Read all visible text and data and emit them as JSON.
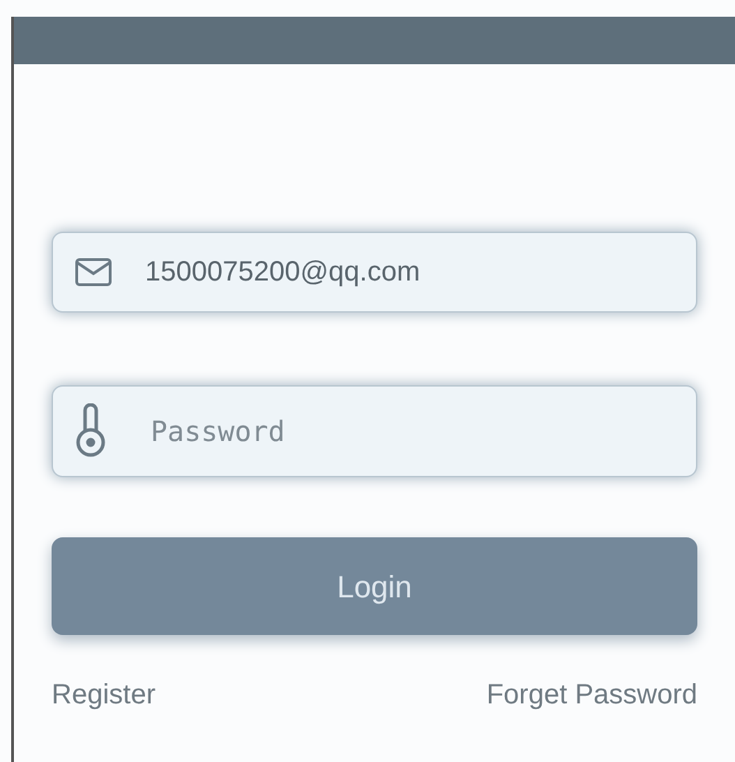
{
  "email_field": {
    "value": "1500075200@qq.com"
  },
  "password_field": {
    "placeholder": "Password"
  },
  "login_button": {
    "label": "Login"
  },
  "links": [
    {
      "label": "Register"
    },
    {
      "label": "Forget Password"
    }
  ]
}
